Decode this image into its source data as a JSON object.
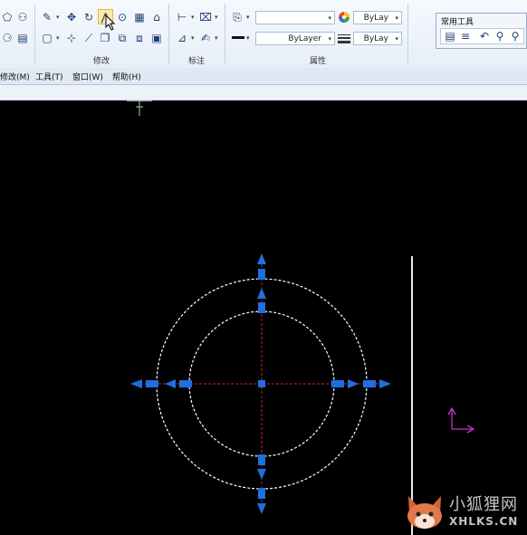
{
  "ribbon": {
    "panels": {
      "modify": "修改",
      "annotation": "标注",
      "properties": "属性"
    },
    "properties": {
      "layer_value": "",
      "color_value": "ByLay",
      "linetype_value": "ByLayer",
      "lineweight_value": "ByLay"
    },
    "common_tools": {
      "title": "常用工具"
    }
  },
  "menubar": {
    "items": [
      "修改(M)",
      "工具(T)",
      "窗口(W)",
      "帮助(H)"
    ]
  },
  "watermark": {
    "chinese": "小狐狸网",
    "latin": "XHLKS.CN"
  },
  "colors": {
    "grip": "#1f6fe0",
    "circle": "#ffffff",
    "centerline": "#c0282c",
    "ucs": "#c830c8"
  },
  "icons": [
    "grid-icon",
    "rotate-icon",
    "move-icon",
    "copy-icon",
    "mirror-icon",
    "array-icon",
    "stretch-icon",
    "rectangle-icon",
    "trim-icon",
    "extend-icon",
    "scale-icon",
    "offset-icon",
    "dimension-icon",
    "match-properties-icon",
    "color-wheel-icon",
    "lineweight-icon",
    "linetype-icon",
    "zoom-icon",
    "pan-icon"
  ]
}
